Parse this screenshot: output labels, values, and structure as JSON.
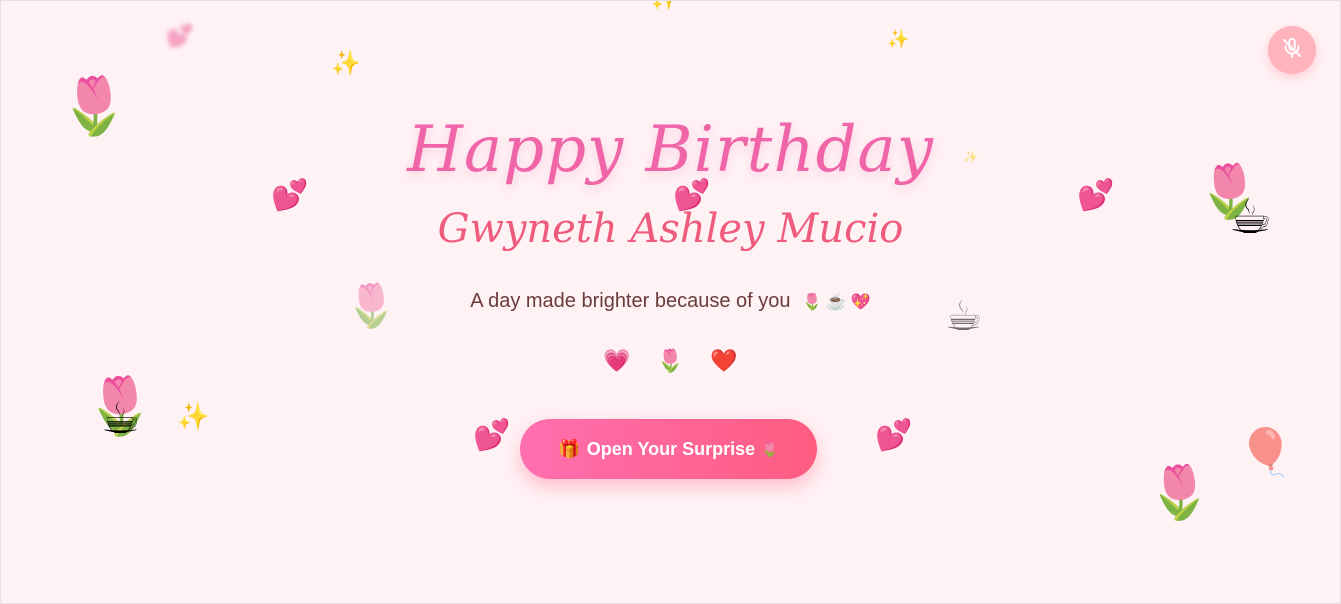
{
  "header": {
    "title": "Happy Birthday",
    "name": "Gwyneth Ashley Mucio"
  },
  "tagline": {
    "text": "A day made brighter because of you",
    "emojis": "🌷 ☕ 💖"
  },
  "icon_row": [
    "💗",
    "🌷",
    "❤️"
  ],
  "cta": {
    "gift": "🎁",
    "label": "Open Your Surprise",
    "tulip": "🌷"
  },
  "mute_button": {
    "icon": "microphone-off-icon"
  },
  "decorations": {
    "tulip": "🌷",
    "coffee": "☕",
    "hearts": "💕",
    "sparkles": "✨",
    "balloon": "🎈"
  },
  "colors": {
    "background": "#fff2f5",
    "title": "#f065a8",
    "name": "#ef5b7c",
    "button_start": "#ff6fb0",
    "button_end": "#ff5c80",
    "mute_button": "#ffb3bd"
  }
}
